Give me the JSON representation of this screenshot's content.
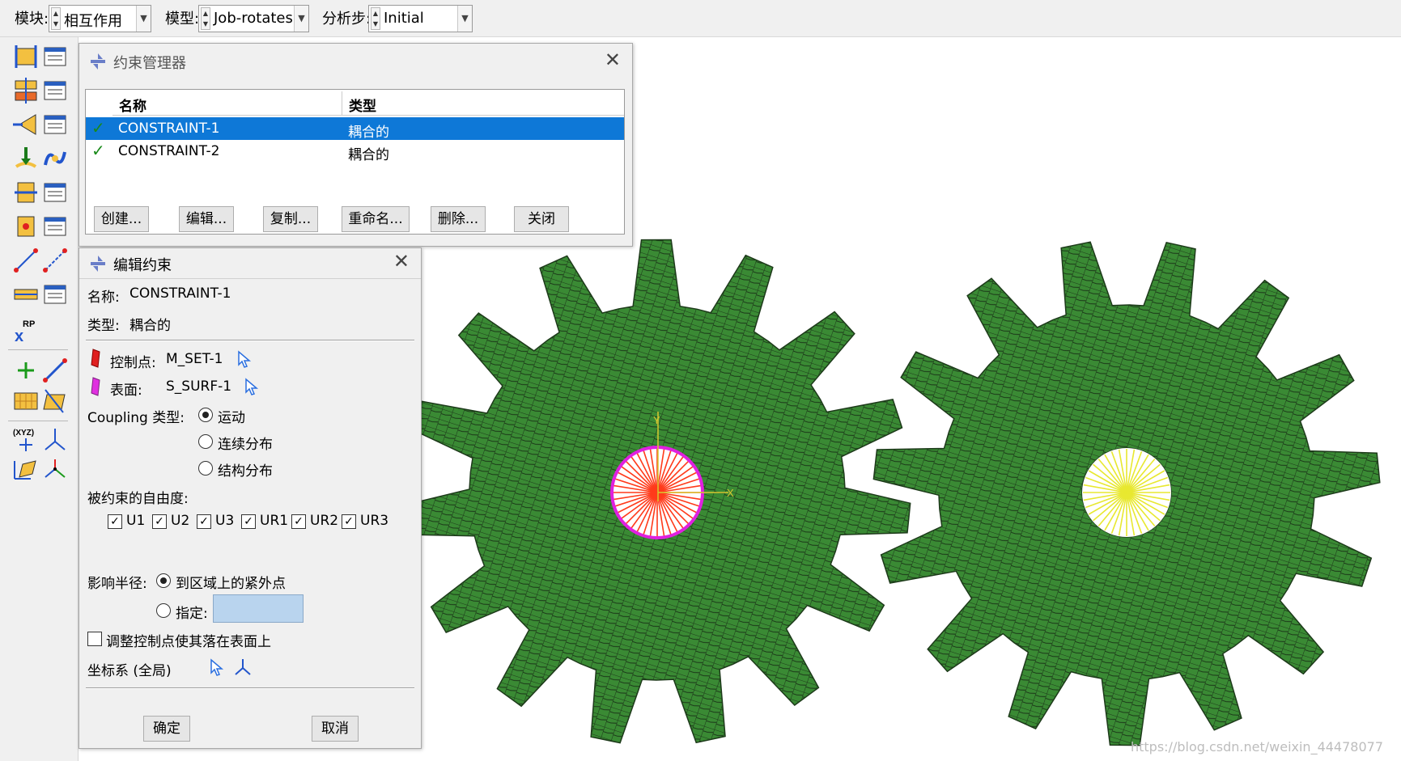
{
  "context": {
    "module_label": "模块:",
    "module_value": "相互作用",
    "model_label": "模型:",
    "model_value": "Job-rotates",
    "step_label": "分析步:",
    "step_value": "Initial"
  },
  "constraint_manager": {
    "title": "约束管理器",
    "columns": [
      "名称",
      "类型"
    ],
    "rows": [
      {
        "name": "CONSTRAINT-1",
        "type": "耦合的",
        "selected": true
      },
      {
        "name": "CONSTRAINT-2",
        "type": "耦合的",
        "selected": false
      }
    ],
    "buttons": [
      "创建...",
      "编辑...",
      "复制...",
      "重命名...",
      "删除...",
      "关闭"
    ]
  },
  "edit_constraint": {
    "title": "编辑约束",
    "name_label": "名称:",
    "name_value": "CONSTRAINT-1",
    "type_label": "类型:",
    "type_value": "耦合的",
    "control_point_label": "控制点:",
    "control_point_value": "M_SET-1",
    "surface_label": "表面:",
    "surface_value": "S_SURF-1",
    "coupling_type_label": "Coupling 类型:",
    "coupling_options": [
      "运动",
      "连续分布",
      "结构分布"
    ],
    "coupling_selected": "运动",
    "dof_label": "被约束的自由度:",
    "dofs": [
      {
        "label": "U1",
        "checked": true
      },
      {
        "label": "U2",
        "checked": true
      },
      {
        "label": "U3",
        "checked": true
      },
      {
        "label": "UR1",
        "checked": true
      },
      {
        "label": "UR2",
        "checked": true
      },
      {
        "label": "UR3",
        "checked": true
      }
    ],
    "influence_label": "影响半径:",
    "influence_option_1": "到区域上的紧外点",
    "influence_option_2": "指定:",
    "influence_value": "",
    "adjust_label": "调整控制点使其落在表面上",
    "adjust_checked": false,
    "csys_label": "坐标系 (全局)",
    "ok_label": "确定",
    "cancel_label": "取消"
  },
  "viewport": {
    "gear_color": "#3a8a34",
    "mesh_color": "#1d3a1a",
    "coupling_ring_color": "#e020e0",
    "coupling_spoke_color": "#ff3a1a",
    "second_coupling_color": "#e8e830",
    "axis_y": "Y",
    "axis_x": "X",
    "watermark": "https://blog.csdn.net/weixin_44478077"
  },
  "toolbox": {
    "icons": [
      "create-constraint-icon",
      "constraint-manager-icon",
      "create-interaction-icon",
      "interaction-manager-icon",
      "create-connector-icon",
      "connector-manager-icon",
      "create-load-icon",
      "amplitude-icon",
      "create-section-icon",
      "section-manager-icon",
      "create-field-icon",
      "field-manager-icon",
      "create-wire-icon",
      "create-datum-icon",
      "create-rigid-icon",
      "rigid-manager-icon",
      "reference-point-icon",
      "datum-point-icon",
      "datum-axis-icon",
      "mesh-grid-icon",
      "partition-icon",
      "coordinate-point-icon",
      "csys-icon",
      "transform-icon",
      "triad-icon"
    ]
  }
}
